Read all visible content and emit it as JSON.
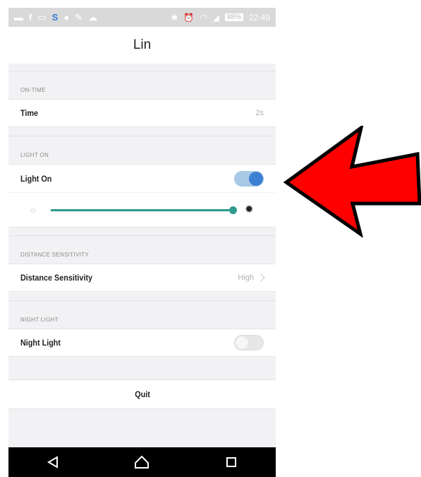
{
  "status_bar": {
    "left_icons": [
      "app-icon-1",
      "facebook-icon",
      "messages-icon",
      "skype-icon",
      "chat-icon",
      "wrench-icon",
      "cloud-icon"
    ],
    "right_icons": [
      "bluetooth-icon",
      "alarm-icon",
      "wifi-icon",
      "signal-icon"
    ],
    "battery": "88%",
    "time": "22:49"
  },
  "app_bar": {
    "title": "Lin"
  },
  "sections": {
    "on_time": {
      "header": "ON-TIME",
      "row_label": "Time",
      "row_value": "2s"
    },
    "light_on": {
      "header": "LIGHT ON",
      "row_label": "Light On",
      "toggle_on": true,
      "brightness_fraction": 1.0
    },
    "distance": {
      "header": "DISTANCE SENSITIVITY",
      "row_label": "Distance Sensitivity",
      "row_value": "High"
    },
    "night_light": {
      "header": "NIGHT LIGHT",
      "row_label": "Night Light",
      "toggle_on": false
    }
  },
  "quit": {
    "label": "Quit"
  },
  "nav_bar": {
    "buttons": [
      "back-icon",
      "home-icon",
      "recents-icon"
    ]
  },
  "annotation": {
    "arrow_color": "#ff0000",
    "points_to": "Light On toggle"
  },
  "colors": {
    "accent_blue": "#3b80d2",
    "slider_teal": "#2e9a8d",
    "arrow_red": "#ff0000"
  }
}
